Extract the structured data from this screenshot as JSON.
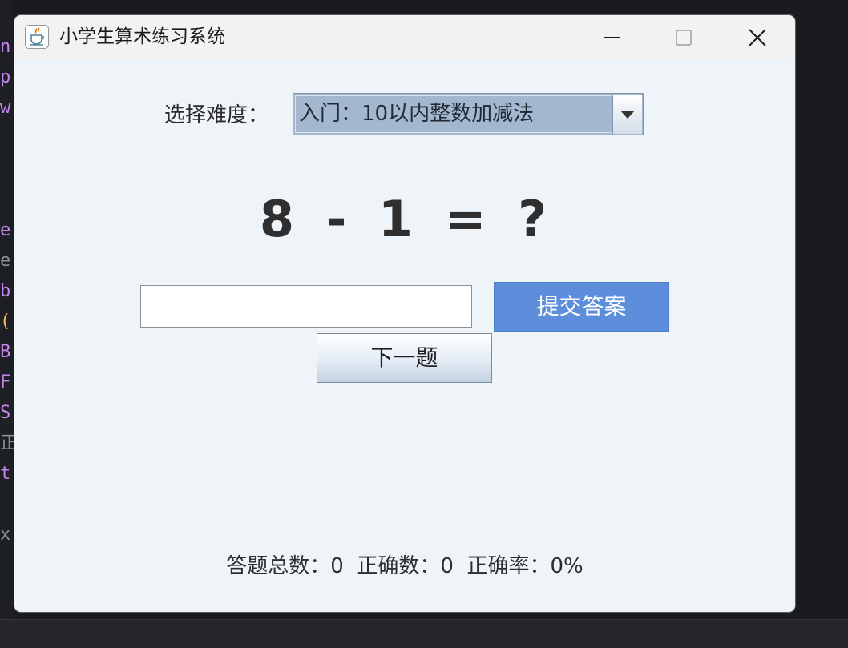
{
  "background_editor": {
    "lines": [
      {
        "text": "n",
        "color": "#c586f0"
      },
      {
        "text": "p",
        "color": "#c586f0"
      },
      {
        "text": "w",
        "color": "#c586f0"
      },
      {
        "text": "e",
        "color": "#c586f0"
      },
      {
        "text": "e",
        "color": "#8c8f96"
      },
      {
        "text": "b",
        "color": "#c586f0"
      },
      {
        "text": "(",
        "color": "#f0c24b"
      },
      {
        "text": "B",
        "color": "#c586f0"
      },
      {
        "text": "F",
        "color": "#c586f0"
      },
      {
        "text": "S",
        "color": "#c586f0"
      },
      {
        "text": "正",
        "color": "#8c8f96"
      },
      {
        "text": "t",
        "color": "#c586f0"
      },
      {
        "text": "x",
        "color": "#8c8f96"
      }
    ]
  },
  "window": {
    "title": "小学生算术练习系统",
    "app_icon": "java-coffee-cup-icon"
  },
  "difficulty": {
    "label": "选择难度：",
    "selected": "入门：10以内整数加减法"
  },
  "question": {
    "text": "8 - 1 = ?"
  },
  "answer": {
    "value": "",
    "submit_label": "提交答案",
    "next_label": "下一题"
  },
  "stats": {
    "text": "答题总数：0  正确数：0  正确率：0%"
  },
  "colors": {
    "window_bg": "#eff4f9",
    "submit_bg": "#5d8edb",
    "combo_bg": "#a3b8cf"
  }
}
